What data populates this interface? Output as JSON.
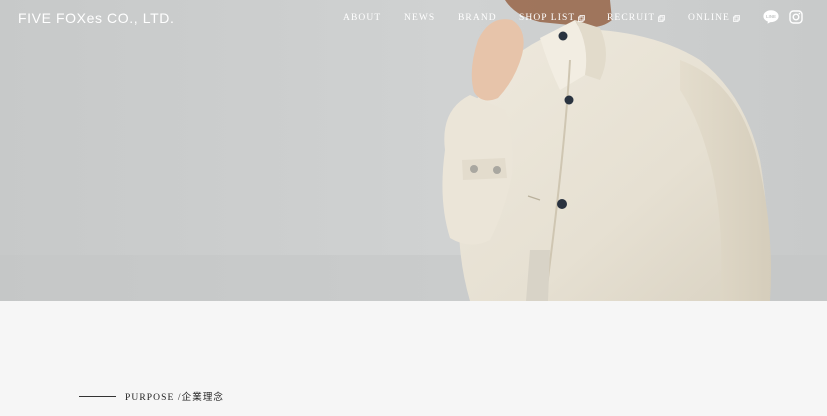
{
  "header": {
    "logo_text": "FIVE FOXes CO., LTD.",
    "nav": [
      {
        "label": "ABOUT",
        "external": false
      },
      {
        "label": "NEWS",
        "external": false
      },
      {
        "label": "BRAND",
        "external": false
      },
      {
        "label": "SHOP LIST",
        "external": true
      },
      {
        "label": "RECRUIT",
        "external": true
      },
      {
        "label": "ONLINE",
        "external": true
      }
    ],
    "social_icons": [
      "line-icon",
      "instagram-icon"
    ]
  },
  "hero": {
    "image_subject": "model-in-cream-coat-photo"
  },
  "section": {
    "purpose_label": "PURPOSE /企業理念"
  },
  "colors": {
    "header_text": "#ffffff",
    "page_background": "#f6f6f6",
    "section_text": "#222222"
  }
}
